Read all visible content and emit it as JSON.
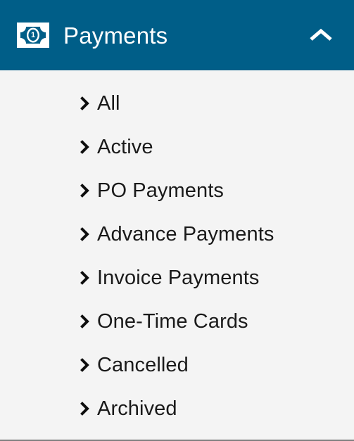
{
  "header": {
    "title": "Payments",
    "icon": "banknote-icon",
    "icon_denomination": "1",
    "toggle_icon": "chevron-up-icon",
    "expanded": true,
    "background_color": "#005e88",
    "text_color": "#ffffff"
  },
  "nav": {
    "item_icon": "chevron-right-icon",
    "items": [
      {
        "label": "All"
      },
      {
        "label": "Active"
      },
      {
        "label": "PO Payments"
      },
      {
        "label": "Advance Payments"
      },
      {
        "label": "Invoice Payments"
      },
      {
        "label": "One-Time Cards"
      },
      {
        "label": "Cancelled"
      },
      {
        "label": "Archived"
      }
    ]
  },
  "theme": {
    "panel_background": "#f4f4f4",
    "accent": "#005e88",
    "label_color": "#1a1a1a",
    "bottom_border_color": "#808080"
  }
}
